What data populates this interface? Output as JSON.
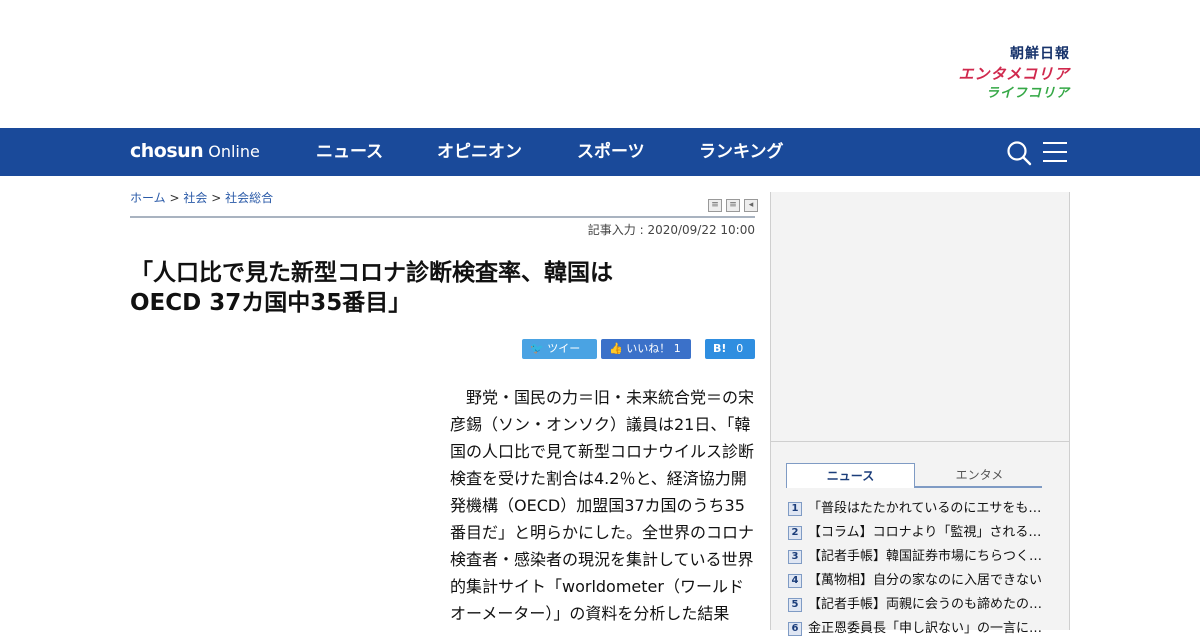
{
  "brands": [
    "朝鮮日報",
    "エンタメコリア",
    "ライフコリア"
  ],
  "nav": {
    "logo_bold": "chosun",
    "logo_light": "Online",
    "items": [
      "ニュース",
      "オピニオン",
      "スポーツ",
      "ランキング"
    ]
  },
  "breadcrumb": {
    "home": "ホーム",
    "sep": ">",
    "section": "社会",
    "subsection": "社会総合"
  },
  "article": {
    "date": "記事入力 : 2020/09/22 10:00",
    "headline_line1": "「人口比で見た新型コロナ診断検査率、韓国は",
    "headline_line2": "OECD 37カ国中35番目」",
    "body": "　野党・国民の力＝旧・未来統合党＝の宋彦錫（ソン・オンソク）議員は21日、「韓国の人口比で見て新型コロナウイルス診断検査を受けた割合は4.2％と、経済協力開発機構（OECD）加盟国37カ国のうち35番目だ」と明らかにした。全世界のコロナ検査者・感染者の現況を集計している世界的集計サイト「worldometer（ワールドオーメーター）」の資料を分析した結果"
  },
  "share": {
    "tweet": "ツイート",
    "like": "いいね！",
    "like_count": "1",
    "hatena": "B!",
    "hatena_count": "0"
  },
  "sidebar": {
    "tabs": [
      "ニュース",
      "エンタメ"
    ],
    "ranking": [
      {
        "rank": "1",
        "title": "「普段はたたかれているのにエサをもらえず…"
      },
      {
        "rank": "2",
        "title": "【コラム】コロナより「監視」される国…"
      },
      {
        "rank": "3",
        "title": "【記者手帳】韓国証券市場にちらつく…"
      },
      {
        "rank": "4",
        "title": "【萬物相】自分の家なのに入居できない"
      },
      {
        "rank": "5",
        "title": "【記者手帳】両親に会うのも諦めたの…"
      },
      {
        "rank": "6",
        "title": "金正恩委員長「申し訳ない」の一言に…"
      }
    ]
  },
  "colors": {
    "nav_bg": "#1a4a9a",
    "link": "#2a5aa8",
    "share_twitter": "#4aa3e3",
    "share_facebook": "#3b71c9",
    "share_hatena": "#2f8ee0"
  }
}
